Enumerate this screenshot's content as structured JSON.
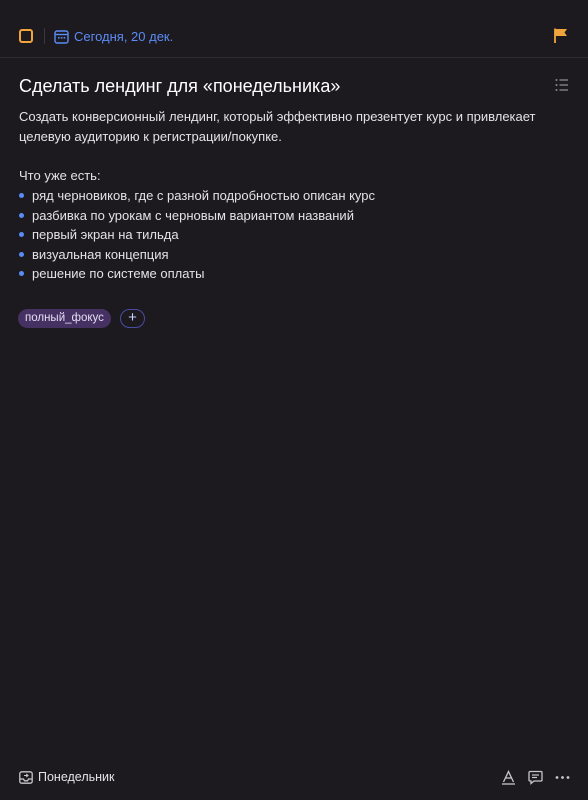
{
  "header": {
    "date_label": "Сегодня, 20 дек.",
    "accent_color": "#5b8cf5",
    "priority_color": "#f0a43c",
    "icons": [
      "checkbox-icon",
      "calendar-icon",
      "flag-icon"
    ]
  },
  "task": {
    "title": "Сделать лендинг для «понедельника»",
    "description_line1": "Создать конверсионный лендинг, который эффективно презентует курс и привлекает",
    "description_line2": "целевую аудиторию к регистрации/покупке.",
    "section_heading": "Что уже есть:",
    "items": [
      "ряд черновиков, где с разной подробностью описан курс",
      "разбивка по урокам с черновым вариантом названий",
      "первый экран на тильда",
      "визуальная концепция",
      "решение по системе оплаты"
    ]
  },
  "tags": {
    "items": [
      "полный_фокус"
    ],
    "add_label": "+",
    "tag_color": "#463262"
  },
  "footer": {
    "project_label": "Понедельник",
    "icons": [
      "inbox-icon",
      "text-format-icon",
      "comment-icon",
      "more-icon"
    ]
  }
}
